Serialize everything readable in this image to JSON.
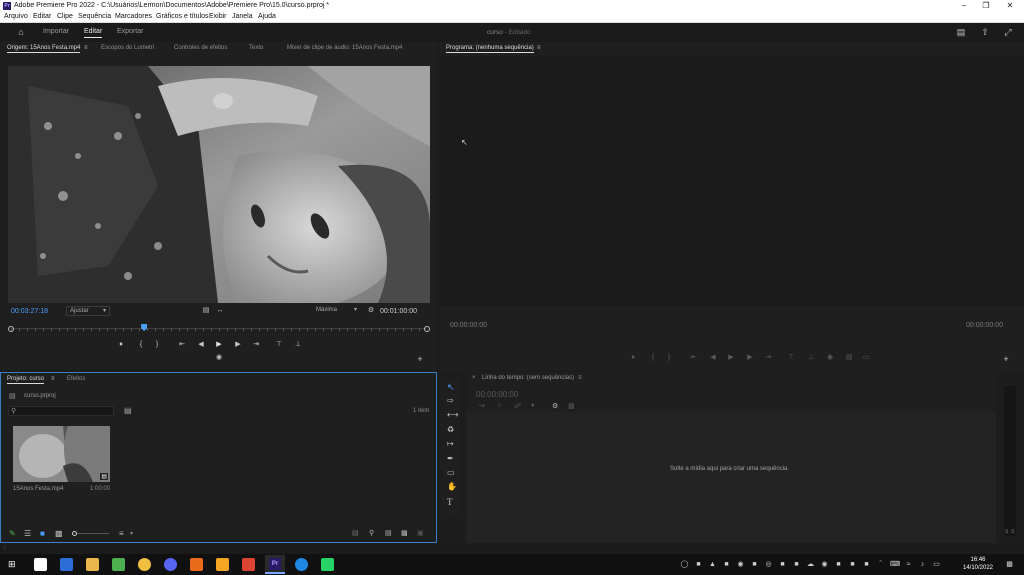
{
  "window": {
    "title": "Adobe Premiere Pro 2022 - C:\\Usuários\\Lermon\\Documentos\\Adobe\\Premiere Pro\\15.0\\curso.prproj *",
    "app_icon_text": "Pr"
  },
  "menu": [
    "Arquivo",
    "Editar",
    "Clipe",
    "Sequência",
    "Marcadores",
    "Gráficos e títulos",
    "Exibir",
    "Janela",
    "Ajuda"
  ],
  "header": {
    "workspaces": [
      "Importar",
      "Editar",
      "Exportar"
    ],
    "active_workspace": "Editar",
    "project_name": "curso",
    "project_state": "- Editado"
  },
  "source_panel": {
    "tabs": [
      "Origem: 15Anos Festa.mp4",
      "Escopos do Lumetri",
      "Controles de efeitos",
      "Texto",
      "Mixer de clipe de áudio: 15Anos Festa.mp4"
    ],
    "current_time": "00:03:27:18",
    "fit_label": "Ajustar",
    "quality_label": "Máxima",
    "duration": "00:01:00:00",
    "playhead_fraction": 0.32
  },
  "program_panel": {
    "tab": "Programa: (nenhuma sequência)",
    "time_left": "00:00:00:00",
    "time_right": "00:00:00:00"
  },
  "project_panel": {
    "tabs": [
      "Projeto: curso",
      "Efeitos"
    ],
    "file_name": "curso.prproj",
    "search_placeholder": "",
    "item_count": "1 item",
    "clip": {
      "name": "15Anos Festa.mp4",
      "duration": "1:00:00"
    }
  },
  "timeline_panel": {
    "tab": "Linha do tempo: (sem sequências)",
    "timecode": "00:00:00:00",
    "drop_hint": "Solte a mídia aqui para criar uma sequência."
  },
  "audio_meter": {
    "labels": [
      "S",
      "S"
    ]
  },
  "taskbar": {
    "time": "16:46",
    "date": "14/10/2022",
    "app_colors": [
      "#ffffff",
      "#e8b64a",
      "#2b6fd6",
      "#f0c040",
      "#4caf50",
      "#dd4433",
      "#5865f2",
      "#e86a1a",
      "#f5a623",
      "#ffffff",
      "#2a1a66",
      "#1e88e5",
      "#25d366"
    ]
  }
}
